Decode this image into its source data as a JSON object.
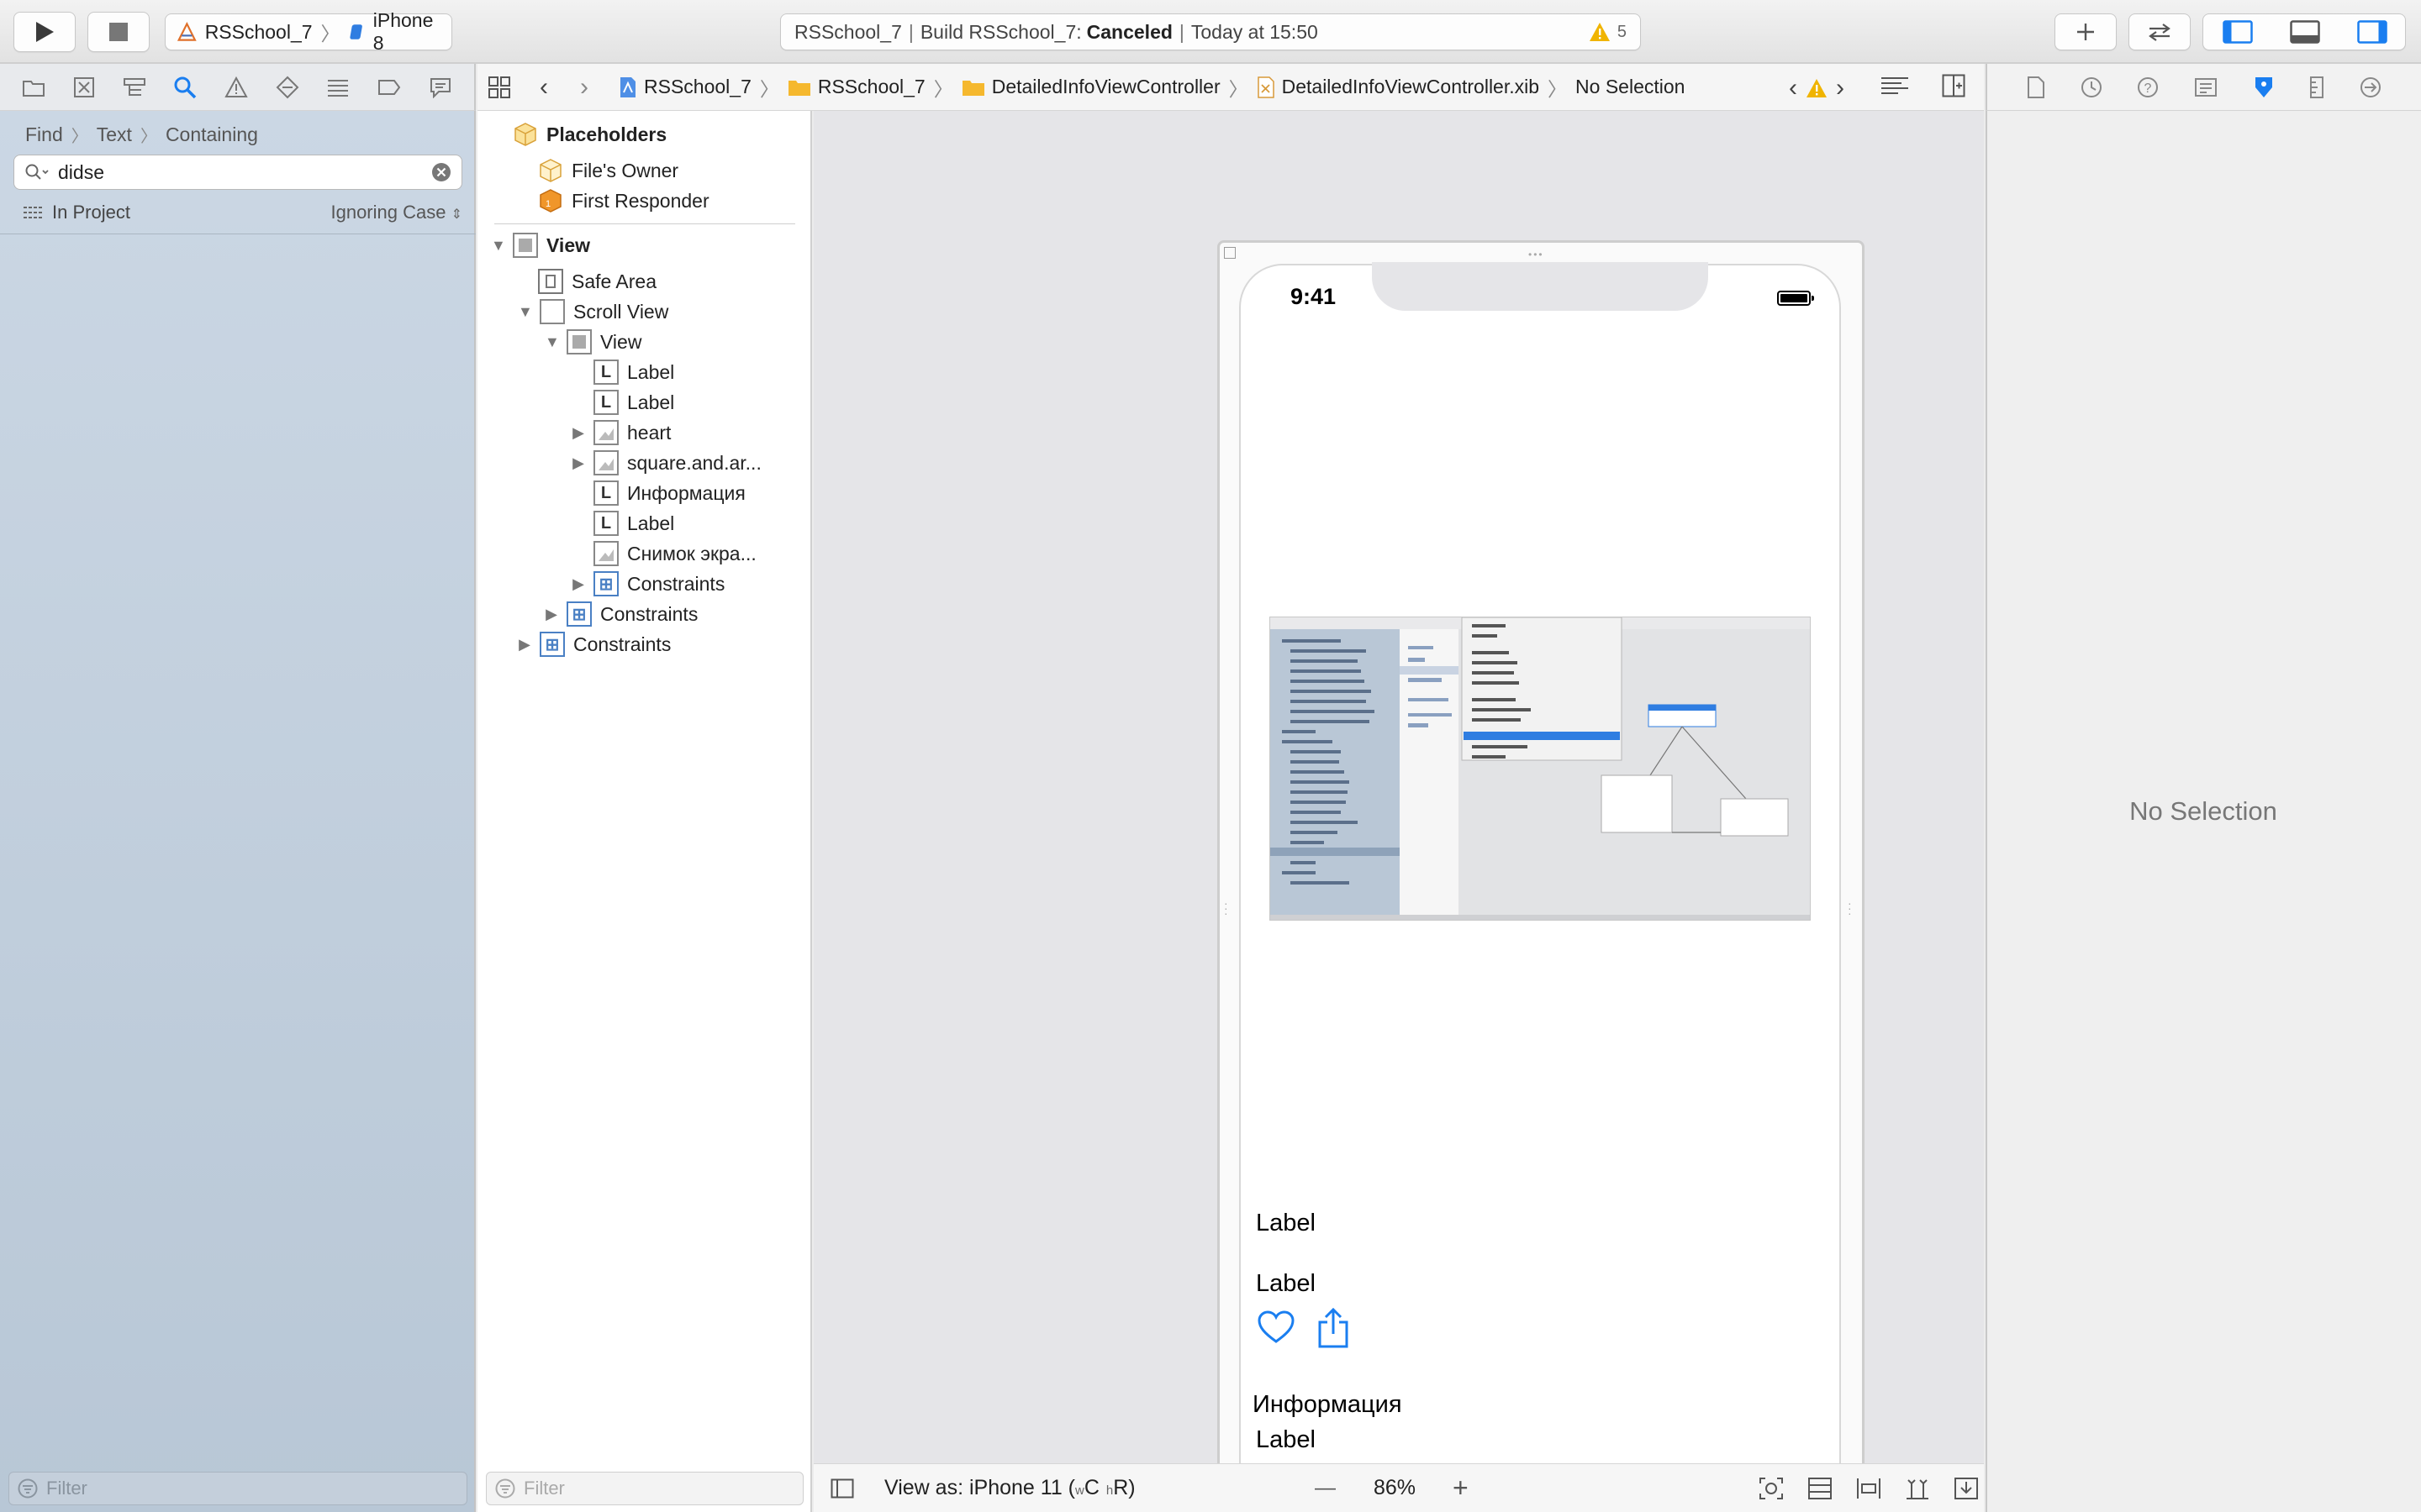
{
  "toolbar": {
    "scheme_name": "RSSchool_7",
    "device_name": "iPhone 8",
    "status_project": "RSSchool_7",
    "status_build_prefix": "Build RSSchool_7:",
    "status_result": "Canceled",
    "status_time": "Today at 15:50",
    "warning_count": "5"
  },
  "navigator": {
    "find_path": [
      "Find",
      "Text",
      "Containing"
    ],
    "search_value": "didse",
    "scope": "In Project",
    "case_mode": "Ignoring Case",
    "filter_placeholder": "Filter"
  },
  "jump_bar": {
    "crumbs": [
      "RSSchool_7",
      "RSSchool_7",
      "DetailedInfoViewController",
      "DetailedInfoViewController.xib",
      "No Selection"
    ]
  },
  "outline": {
    "placeholders_title": "Placeholders",
    "files_owner": "File's Owner",
    "first_responder": "First Responder",
    "view": "View",
    "safe_area": "Safe Area",
    "scroll_view": "Scroll View",
    "inner_view": "View",
    "label_1": "Label",
    "label_2": "Label",
    "heart": "heart",
    "square": "square.and.ar...",
    "info": "Информация",
    "label_3": "Label",
    "snapshot": "Снимок экра...",
    "constraints_inner": "Constraints",
    "constraints_scroll": "Constraints",
    "constraints_root": "Constraints",
    "filter_placeholder": "Filter"
  },
  "canvas": {
    "time": "9:41",
    "label_a": "Label",
    "label_b": "Label",
    "info_label": "Информация",
    "label_c": "Label",
    "view_as": "View as: iPhone 11 (",
    "size_class_w": "w",
    "size_class_w_val": "C",
    "size_class_h": "h",
    "size_class_h_val": "R)",
    "zoom": "86%",
    "zoom_minus": "—",
    "zoom_plus": "+"
  },
  "inspector": {
    "no_selection": "No Selection"
  },
  "colors": {
    "accent": "#1a7ef0",
    "warning": "#f0b400",
    "folder": "#f5b82e"
  }
}
